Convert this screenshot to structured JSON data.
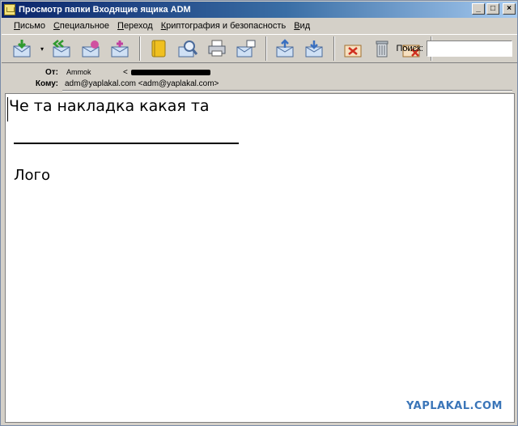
{
  "window": {
    "title": "Просмотр папки Входящие ящика ADM"
  },
  "title_buttons": {
    "minimize": "_",
    "maximize": "□",
    "close": "×"
  },
  "menu": [
    {
      "label": "Письмо"
    },
    {
      "label": "Специальное"
    },
    {
      "label": "Переход"
    },
    {
      "label": "Криптография и безопасность"
    },
    {
      "label": "Вид"
    }
  ],
  "toolbar": {
    "dropdown_glyph": "▾",
    "search_label": "Поиск:",
    "search_value": ""
  },
  "header": {
    "from_label": "От:",
    "from_name": "Ammok",
    "from_bracket": "<",
    "to_label": "Кому:",
    "to_value": "adm@yaplakal.com <adm@yaplakal.com>"
  },
  "message": {
    "line1": "Че та накладка какая та",
    "logo": "Лого"
  },
  "watermark": "YAPLAKAL.COM",
  "colors": {
    "titlebar_start": "#0a246a",
    "titlebar_end": "#a6caf0",
    "chrome": "#d4d0c8",
    "watermark": "#3a75b8"
  }
}
